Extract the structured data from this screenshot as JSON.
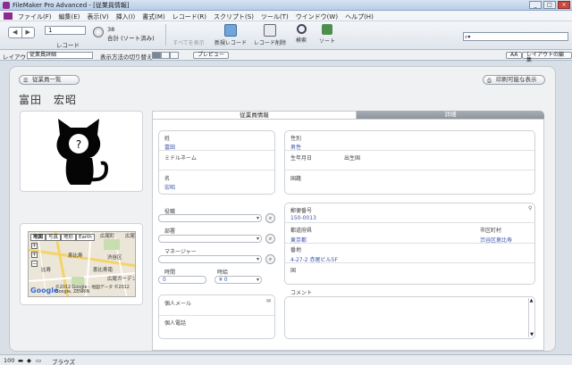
{
  "window": {
    "title": "FileMaker Pro Advanced - [従業員情報]"
  },
  "menu": [
    "ファイル(F)",
    "編集(E)",
    "表示(V)",
    "挿入(I)",
    "書式(M)",
    "レコード(R)",
    "スクリプト(S)",
    "ツール(T)",
    "ウインドウ(W)",
    "ヘルプ(H)"
  ],
  "toolbar": {
    "record_number": "1",
    "record_label": "レコード",
    "total": "38",
    "total_sub": "合計 (ソート済み)",
    "show_all": "すべてを表示",
    "new_record": "新規レコード",
    "delete_record": "レコード削除",
    "find": "検索",
    "sort": "ソート"
  },
  "layoutbar": {
    "layout_label": "レイアウト:",
    "layout_value": "従業員詳細",
    "view_as": "表示方法の切り替え:",
    "preview": "プレビュー",
    "aa": "AA",
    "edit_layout": "レイアウトの編集"
  },
  "content": {
    "list_button": "従業員一覧",
    "print_button": "印刷可能な表示",
    "employee_name": "富田　宏昭",
    "tab_active": "従業員情報",
    "tab_inactive": "詳細"
  },
  "fields": {
    "last_name_label": "姓",
    "last_name": "富田",
    "middle_name_label": "ミドルネーム",
    "first_name_label": "名",
    "first_name": "宏昭",
    "gender_label": "性別",
    "gender": "男性",
    "birthday_label": "生年月日",
    "birthplace_label": "出生国",
    "nationality_label": "国籍",
    "position_label": "役職",
    "department_label": "部署",
    "manager_label": "マネージャー",
    "hours_label": "時間",
    "hours": "0",
    "wage_label": "時給",
    "wage": "¥ 0",
    "email_label": "個人メール",
    "phone_label": "個人電話",
    "postal_label": "郵便番号",
    "postal": "150-0013",
    "prefecture_label": "都道府県",
    "prefecture": "東京都",
    "city_label": "市区町村",
    "city": "渋谷区恵比寿",
    "street_label": "番地",
    "street": "4-27-2 赤尾ビル5F",
    "country_label": "国",
    "comment_label": "コメント"
  },
  "map": {
    "tabs": [
      "地図",
      "写真",
      "地形",
      "Earth"
    ],
    "labels": [
      "比寿",
      "広尾町",
      "恵比寿",
      "渋谷区",
      "広尾",
      "恵比寿南",
      "広尾ガーデン"
    ],
    "copyright": "©2012 Google - 地図データ ©2012 Google, ZENRIN",
    "brand": "Google"
  },
  "status": {
    "zoom": "100",
    "mode": "ブラウズ"
  }
}
